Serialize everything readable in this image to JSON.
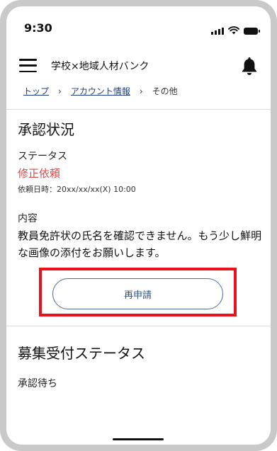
{
  "status_bar": {
    "time": "9:30",
    "icons": [
      "signal-icon",
      "wifi-icon",
      "battery-icon"
    ]
  },
  "app_bar": {
    "title": "学校×地域人材バンク",
    "menu_icon": "hamburger-menu-icon",
    "notification_icon": "bell-icon"
  },
  "breadcrumb": {
    "items": [
      "トップ",
      "アカウント情報",
      "その他"
    ],
    "separator": "›"
  },
  "approval": {
    "heading": "承認状況",
    "status_label": "ステータス",
    "status_value": "修正依頼",
    "request_date": "依頼日時：20xx/xx/xx(X) 10:00",
    "content_label": "内容",
    "content_text": "教員免許状の氏名を確認できません。もう少し鮮明な画像の添付をお願いします。",
    "reapply_button": "再申請"
  },
  "recruitment": {
    "heading": "募集受付ステータス",
    "value": "承認待ち"
  },
  "colors": {
    "status_alert": "#d94a4a",
    "link": "#1f3f78",
    "button_border": "#4a6d9c",
    "highlight_box": "#e8121c"
  }
}
